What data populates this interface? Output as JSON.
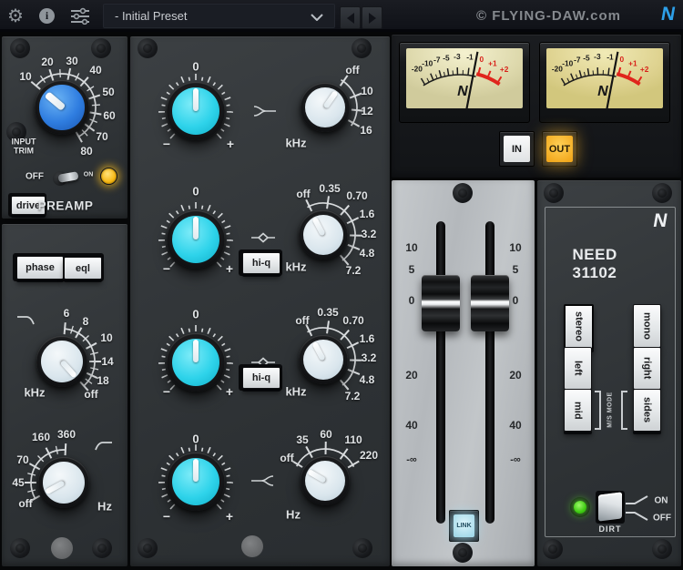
{
  "topbar": {
    "preset": "- Initial Preset",
    "copyright": "© FLYING-DAW.com",
    "logo": "N"
  },
  "preamp": {
    "title": "PREAMP",
    "drive": "drive",
    "input_trim": "INPUT TRIM",
    "off": "OFF",
    "on": "ON",
    "gain_scale": [
      "10",
      "20",
      "30",
      "40",
      "50",
      "60",
      "70",
      "80"
    ]
  },
  "left_eq": {
    "phase": "phase",
    "eql": "eql",
    "lpf": {
      "unit": "kHz",
      "scale": [
        "6",
        "8",
        "10",
        "14",
        "18",
        "off"
      ]
    },
    "hpf": {
      "unit": "Hz",
      "scale": [
        "off",
        "45",
        "70",
        "160",
        "360"
      ]
    }
  },
  "eq_bands": {
    "gain_zero": "0",
    "gain_minus": "−",
    "gain_plus": "+",
    "hi_q": "hi-q",
    "high_shelf": {
      "unit": "kHz",
      "scale": [
        "off",
        "10",
        "12",
        "16"
      ]
    },
    "high_mid": {
      "unit": "kHz",
      "scale": [
        "off",
        "0.35",
        "0.70",
        "1.6",
        "3.2",
        "4.8",
        "7.2"
      ]
    },
    "low_mid": {
      "unit": "kHz",
      "scale": [
        "off",
        "0.35",
        "0.70",
        "1.6",
        "3.2",
        "4.8",
        "7.2"
      ]
    },
    "low_shelf": {
      "unit": "Hz",
      "scale": [
        "off",
        "35",
        "60",
        "110",
        "220"
      ]
    }
  },
  "meters": {
    "ticks": [
      "-20",
      "-10",
      "-7",
      "-5",
      "-3",
      "-1",
      "0",
      "+1",
      "+2"
    ],
    "logo": "N",
    "in": "IN",
    "out": "OUT"
  },
  "faders": {
    "scale": [
      "10",
      "5",
      "0",
      "20",
      "40",
      "-∞"
    ],
    "link": "LINK"
  },
  "master": {
    "logo": "N",
    "title": "NEED 31102",
    "modes_left": [
      "stereo",
      "left",
      "mid"
    ],
    "modes_right": [
      "mono",
      "right",
      "sides"
    ],
    "ms_mode": "M/S MODE",
    "dirt": "DIRT",
    "on": "ON",
    "off": "OFF"
  }
}
